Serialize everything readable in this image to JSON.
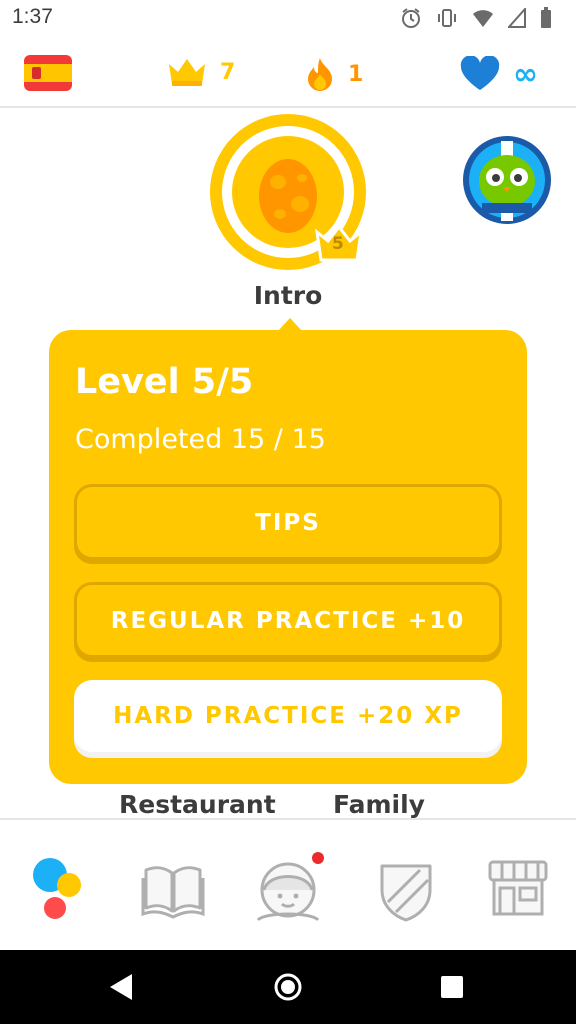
{
  "status_bar": {
    "time": "1:37"
  },
  "stats": {
    "crowns": "7",
    "streak": "1",
    "hearts": "∞"
  },
  "skill": {
    "name": "Intro",
    "crown_level": "5"
  },
  "popover": {
    "level": "Level 5/5",
    "completed": "Completed 15 / 15",
    "tips_label": "TIPS",
    "regular_label": "REGULAR PRACTICE +10",
    "hard_label": "HARD PRACTICE +20 XP"
  },
  "next_skills": [
    "Restaurant",
    "Family"
  ],
  "colors": {
    "gold": "#ffc800",
    "gold_dark": "#dfa800",
    "orange": "#ff9600",
    "blue": "#1cb0f6",
    "heart_blue": "#1e7fd6"
  }
}
